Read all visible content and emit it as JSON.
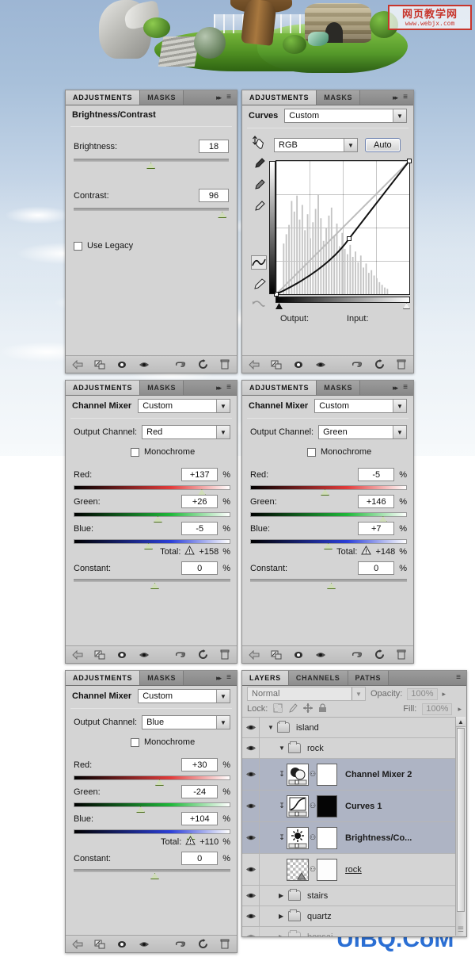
{
  "watermarks": {
    "top_cn": "网页教学网",
    "top_url": "www.webjx.com",
    "bottom": "UiBQ.CoM"
  },
  "common": {
    "tab_adjustments": "ADJUSTMENTS",
    "tab_masks": "MASKS",
    "expand_icon": "▸▸",
    "menu_icon": "≡",
    "footer_icons": [
      "back-arrow-icon",
      "expand-view-icon",
      "clip-to-layer-icon",
      "toggle-visibility-icon",
      "preview-eye-icon",
      "reset-icon",
      "delete-icon"
    ],
    "percent": "%"
  },
  "brightness_panel": {
    "title": "Brightness/Contrast",
    "brightness_label": "Brightness:",
    "brightness_value": "18",
    "brightness_slider_pct": 51,
    "contrast_label": "Contrast:",
    "contrast_value": "96",
    "contrast_slider_pct": 96,
    "use_legacy_label": "Use Legacy",
    "use_legacy_checked": false
  },
  "curves_panel": {
    "title": "Curves",
    "preset_value": "Custom",
    "channel_value": "RGB",
    "auto_label": "Auto",
    "output_label": "Output:",
    "input_label": "Input:",
    "output_value": "",
    "input_value": "",
    "tools": [
      "on-image-adjust-icon",
      "black-point-eyedropper-icon",
      "gray-point-eyedropper-icon",
      "white-point-eyedropper-icon",
      "curve-point-tool-icon",
      "pencil-tool-icon",
      "smooth-curve-icon"
    ],
    "curve_points": [
      [
        0,
        0
      ],
      [
        55,
        42
      ],
      [
        100,
        100
      ]
    ],
    "black_input": 0,
    "white_input": 255
  },
  "mixer_red": {
    "title": "Channel Mixer",
    "preset_value": "Custom",
    "output_channel_label": "Output Channel:",
    "output_channel_value": "Red",
    "monochrome_label": "Monochrome",
    "monochrome_checked": false,
    "red_label": "Red:",
    "red_value": "+137",
    "red_pct": 79,
    "green_label": "Green:",
    "green_value": "+26",
    "green_pct": 51,
    "blue_label": "Blue:",
    "blue_value": "-5",
    "blue_pct": 45,
    "total_label": "Total:",
    "total_value": "+158",
    "constant_label": "Constant:",
    "constant_value": "0",
    "constant_pct": 50
  },
  "mixer_green": {
    "title": "Channel Mixer",
    "preset_value": "Custom",
    "output_channel_label": "Output Channel:",
    "output_channel_value": "Green",
    "monochrome_label": "Monochrome",
    "monochrome_checked": false,
    "red_label": "Red:",
    "red_value": "-5",
    "red_pct": 45,
    "green_label": "Green:",
    "green_value": "+146",
    "green_pct": 82,
    "blue_label": "Blue:",
    "blue_value": "+7",
    "blue_pct": 47,
    "total_label": "Total:",
    "total_value": "+148",
    "constant_label": "Constant:",
    "constant_value": "0",
    "constant_pct": 50
  },
  "mixer_blue": {
    "title": "Channel Mixer",
    "preset_value": "Custom",
    "output_channel_label": "Output Channel:",
    "output_channel_value": "Blue",
    "monochrome_label": "Monochrome",
    "monochrome_checked": false,
    "red_label": "Red:",
    "red_value": "+30",
    "red_pct": 52,
    "green_label": "Green:",
    "green_value": "-24",
    "green_pct": 40,
    "blue_label": "Blue:",
    "blue_value": "+104",
    "blue_pct": 72,
    "total_label": "Total:",
    "total_value": "+110",
    "constant_label": "Constant:",
    "constant_value": "0",
    "constant_pct": 50
  },
  "layers_panel": {
    "tabs": [
      "LAYERS",
      "CHANNELS",
      "PATHS"
    ],
    "active_tab": "LAYERS",
    "blend_mode": "Normal",
    "opacity_label": "Opacity:",
    "opacity_value": "100%",
    "lock_label": "Lock:",
    "fill_label": "Fill:",
    "fill_value": "100%",
    "lock_icons": [
      "lock-transparency-icon",
      "lock-image-icon",
      "lock-position-icon",
      "lock-all-icon"
    ],
    "rows": [
      {
        "name": "island",
        "type": "group",
        "indent": 0,
        "expanded": true,
        "selected": false,
        "visible": true
      },
      {
        "name": "rock",
        "type": "group",
        "indent": 1,
        "expanded": true,
        "selected": false,
        "visible": true
      },
      {
        "name": "Channel Mixer 2",
        "type": "adjust",
        "indent": 2,
        "selected": true,
        "visible": true,
        "mask": "white",
        "icon": "channel-mixer-icon",
        "clipped": true
      },
      {
        "name": "Curves 1",
        "type": "adjust",
        "indent": 2,
        "selected": true,
        "visible": true,
        "mask": "black",
        "icon": "curves-icon",
        "clipped": true
      },
      {
        "name": "Brightness/Co...",
        "type": "adjust",
        "indent": 2,
        "selected": true,
        "visible": true,
        "mask": "white",
        "icon": "brightness-icon",
        "clipped": true
      },
      {
        "name": "rock",
        "type": "pixel",
        "indent": 2,
        "selected": false,
        "visible": true,
        "mask": "white"
      },
      {
        "name": "stairs",
        "type": "group",
        "indent": 1,
        "expanded": false,
        "selected": false,
        "visible": true
      },
      {
        "name": "quartz",
        "type": "group",
        "indent": 1,
        "expanded": false,
        "selected": false,
        "visible": true
      },
      {
        "name": "bonsai",
        "type": "group",
        "indent": 1,
        "expanded": false,
        "selected": false,
        "visible": true
      }
    ]
  }
}
